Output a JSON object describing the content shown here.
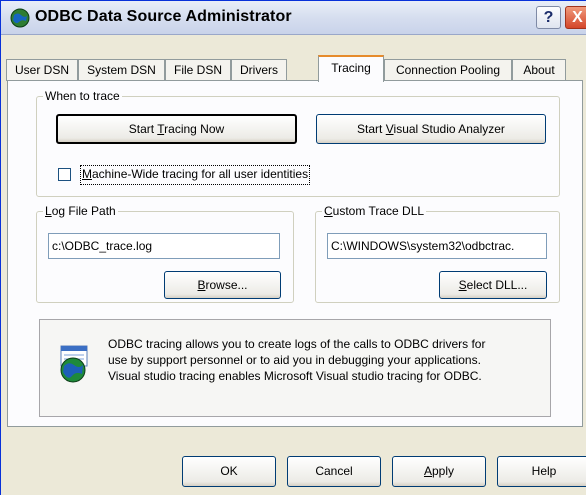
{
  "window": {
    "title": "ODBC Data Source Administrator"
  },
  "titlebar": {
    "help_label": "?",
    "close_label": "X"
  },
  "tabs": [
    {
      "label": "User DSN"
    },
    {
      "label": "System DSN"
    },
    {
      "label": "File DSN"
    },
    {
      "label": "Drivers"
    },
    {
      "label": "Tracing",
      "active": true
    },
    {
      "label": "Connection Pooling"
    },
    {
      "label": "About"
    }
  ],
  "when_to_trace": {
    "legend": "When to trace",
    "start_tracing": {
      "before": "Start ",
      "accel": "T",
      "after": "racing Now"
    },
    "start_vs": {
      "before": "Start ",
      "accel": "V",
      "after": "isual Studio Analyzer"
    },
    "machine_wide": {
      "before": "",
      "accel": "M",
      "after": "achine-Wide tracing for all user identities",
      "checked": false
    }
  },
  "log_file": {
    "legend_accel": "L",
    "legend_rest": "og File Path",
    "value": "c:\\ODBC_trace.log",
    "browse": {
      "accel": "B",
      "after": "rowse..."
    }
  },
  "custom_dll": {
    "legend_accel": "C",
    "legend_rest": "ustom Trace DLL",
    "value": "C:\\WINDOWS\\system32\\odbctrac.",
    "select": {
      "before": "",
      "accel": "S",
      "after": "elect DLL..."
    }
  },
  "info": {
    "icon": "odbc-globe-icon",
    "lines": [
      "ODBC tracing allows you to create logs of the calls to ODBC drivers for",
      "use by support personnel or to aid you in debugging your applications.",
      "Visual studio tracing enables Microsoft Visual studio tracing for ODBC."
    ]
  },
  "footer": {
    "ok": "OK",
    "cancel": "Cancel",
    "apply": {
      "accel": "A",
      "after": "pply"
    },
    "help": "Help"
  }
}
